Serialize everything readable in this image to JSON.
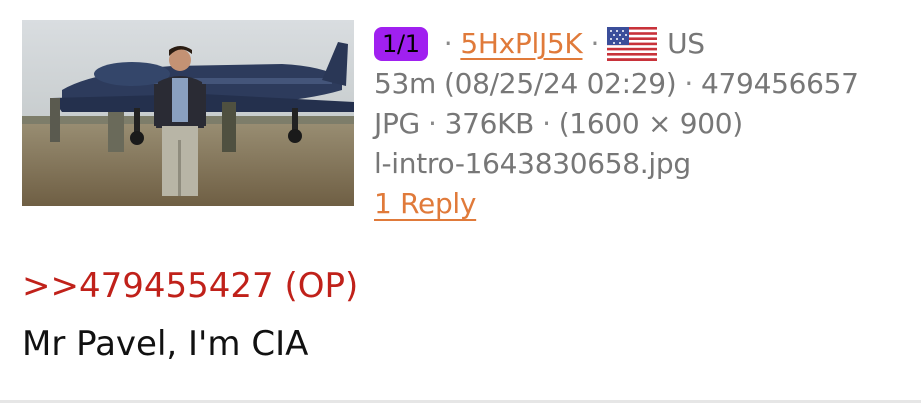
{
  "post": {
    "index_badge": "1/1",
    "poster_id": "5HxPlJ5K",
    "flag_icon": "us-flag-icon",
    "country": "US",
    "age": "53m",
    "datetime": "(08/25/24 02:29)",
    "post_number": "479456657",
    "file_type": "JPG",
    "file_size": "376KB",
    "dimensions": "(1600 × 900)",
    "filename": "l-intro-1643830658.jpg",
    "replies_label": "1 Reply",
    "separator": "·",
    "quote": ">>479455427 (OP)",
    "comment": "Mr Pavel, I'm CIA"
  },
  "colors": {
    "badge": "#a020f0",
    "link": "#e07a3a",
    "quote": "#c0211a",
    "meta_text": "#777777"
  }
}
